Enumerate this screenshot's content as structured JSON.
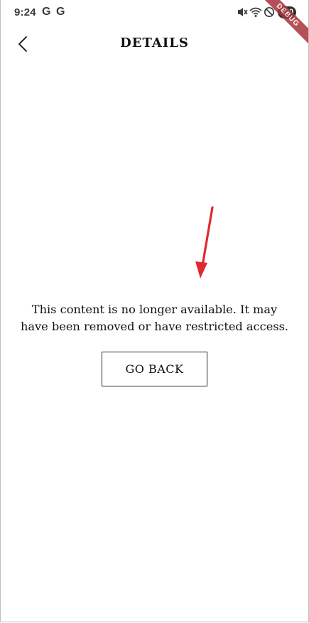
{
  "status_bar": {
    "time": "9:24",
    "notif_g1": "G",
    "notif_g2": "G",
    "battery": "100",
    "icons": [
      "mute-icon",
      "wifi-icon",
      "do-not-disturb-icon",
      "battery-icon"
    ]
  },
  "debug_banner": "DEBUG",
  "header": {
    "title": "DETAILS",
    "back_icon": "chevron-left-icon"
  },
  "annotation": {
    "icon": "red-arrow-icon",
    "color": "#e02a2f"
  },
  "main": {
    "message": "This content is no longer available. It may have been removed or have restricted access.",
    "go_back_label": "GO BACK"
  }
}
